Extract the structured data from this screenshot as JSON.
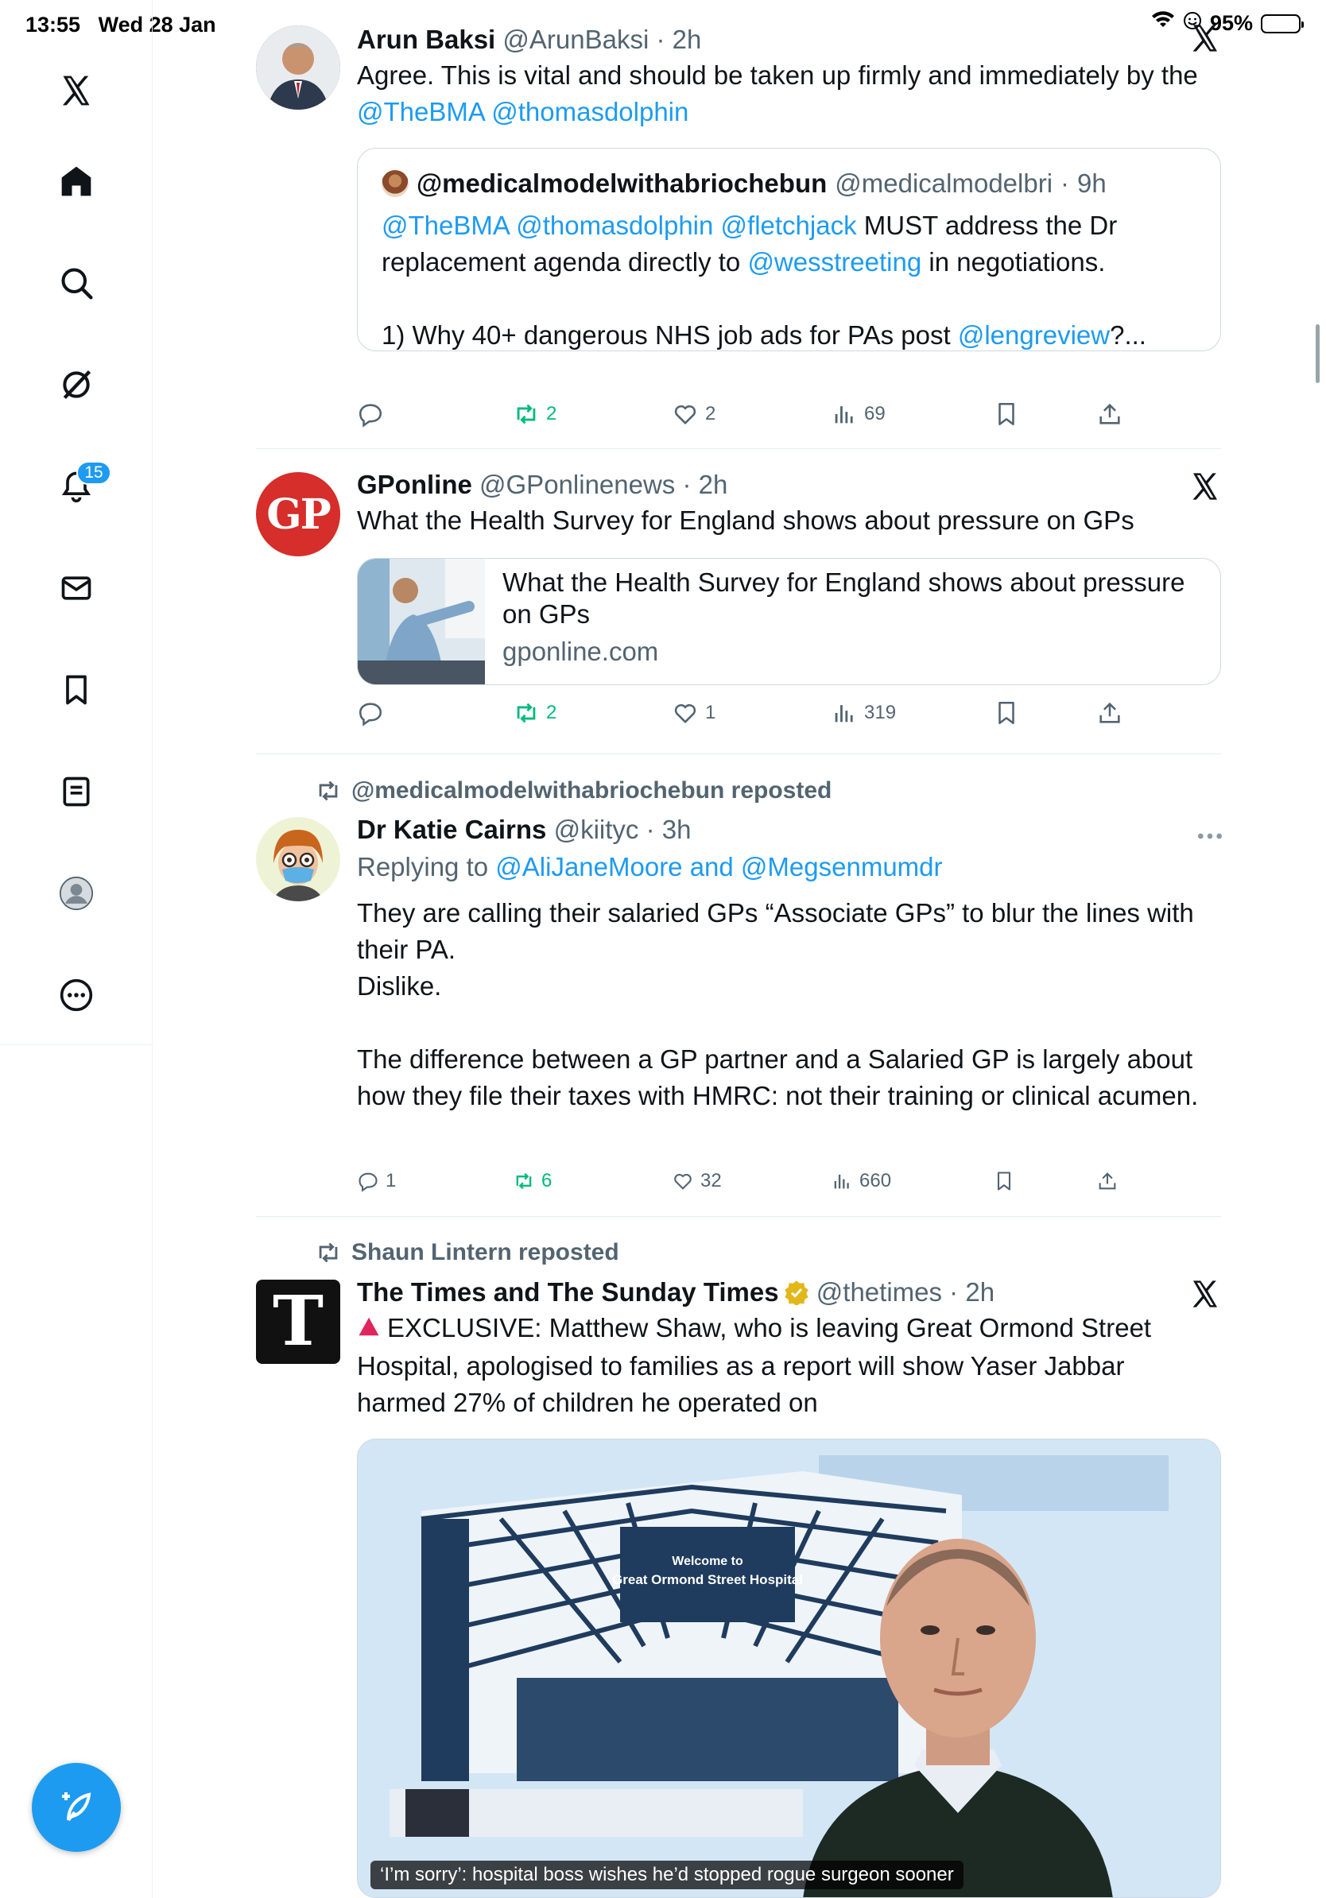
{
  "status": {
    "time": "13:55",
    "date": "Wed 28 Jan",
    "battery": "95%"
  },
  "nav": {
    "notifications_badge": "15",
    "items": [
      "x-logo-icon",
      "home-icon",
      "search-icon",
      "grok-icon",
      "notifications-icon",
      "messages-icon",
      "bookmarks-icon",
      "lists-icon",
      "profile-icon",
      "more-icon"
    ]
  },
  "tweets": [
    {
      "name": "Arun Baksi",
      "handle": "@ArunBaksi",
      "time": "2h",
      "text_plain": "Agree. This is vital and should be taken up firmly and immediately by the ",
      "text_links": "@TheBMA @thomasdolphin",
      "quote": {
        "name": "@medicalmodelwithabriochebun",
        "handle": "@medicalmodelbri",
        "time": "9h",
        "line1_links": "@TheBMA @thomasdolphin @fletchjack",
        "line1_text": " MUST address the Dr replacement agenda directly to ",
        "line1_link2": "@wesstreeting",
        "line1_end": " in negotiations.",
        "line2_text": "1) Why 40+ dangerous NHS job ads for PAs post ",
        "line2_link": "@lengreview",
        "line2_end": "?..."
      },
      "replies": "",
      "reposts": "2",
      "likes": "2",
      "views": "69"
    },
    {
      "name": "GPonline",
      "handle": "@GPonlinenews",
      "time": "2h",
      "text": "What the Health Survey for England shows about pressure on GPs",
      "avatar_text": "GP",
      "card": {
        "title": "What the Health Survey for England shows about pressure on GPs",
        "domain": "gponline.com"
      },
      "replies": "",
      "reposts": "2",
      "likes": "1",
      "views": "319"
    },
    {
      "reposted_by": "@medicalmodelwithabriochebun reposted",
      "name": "Dr Katie Cairns",
      "handle": "@kiityc",
      "time": "3h",
      "replying_label": "Replying to ",
      "replying_to": "@AliJaneMoore and @Megsenmumdr",
      "para1": "They are calling their salaried GPs  “Associate GPs” to blur the lines with their PA.",
      "para2": "Dislike.",
      "para3": "The difference between a GP partner and a Salaried GP is largely about how they file their taxes with HMRC: not their training or clinical acumen.",
      "replies": "1",
      "reposts": "6",
      "likes": "32",
      "views": "660"
    },
    {
      "reposted_by": "Shaun Lintern reposted",
      "name": "The Times and The Sunday Times",
      "handle": "@thetimes",
      "time": "2h",
      "avatar_text": "T",
      "text": "EXCLUSIVE: Matthew Shaw, who is leaving Great Ormond Street Hospital, apologised to families as a report will show Yaser Jabbar harmed 27% of children he operated on",
      "media": {
        "sign_line1": "Welcome to",
        "sign_line2": "Great Ormond Street Hospital",
        "caption": "‘I’m sorry’: hospital boss wishes he’d stopped rogue surgeon sooner"
      }
    }
  ],
  "separator": "·",
  "colors": {
    "accent": "#1d9bf0",
    "repost": "#00ba7c",
    "muted": "#536471",
    "gp_red": "#d62e2a"
  }
}
